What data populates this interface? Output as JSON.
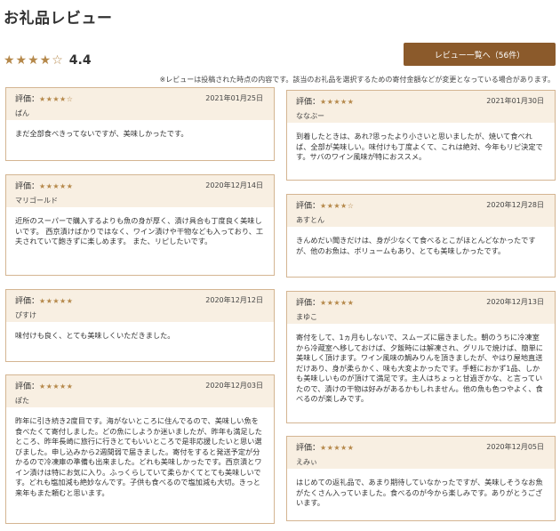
{
  "page_title": "お礼品レビュー",
  "summary": {
    "stars": "★★★★☆",
    "average": "4.4"
  },
  "list_button": "レビュー一覧へ（56件）",
  "notice": "※レビューは投稿された時点の内容です。該当のお礼品を選択するための寄付金額などが変更となっている場合があります。",
  "rating_label": "評価：",
  "reviews_left": [
    {
      "stars": "★★★★☆",
      "date": "2021年01月25日",
      "user": "ぱん",
      "text": "まだ全部食べきってないですが、美味しかったです。"
    },
    {
      "stars": "★★★★★",
      "date": "2020年12月14日",
      "user": "マリゴールド",
      "text": "近所のスーパーで購入するよりも魚の身が厚く、漬け具合も丁度良く美味しいです。 西京漬けばかりではなく、ワイン漬けや干物なども入っており、工夫されていて飽きずに楽しめます。 また、リピしたいです。"
    },
    {
      "stars": "★★★★★",
      "date": "2020年12月12日",
      "user": "ぴすけ",
      "text": "味付けも良く、とても美味しくいただきました。"
    },
    {
      "stars": "★★★★★",
      "date": "2020年12月03日",
      "user": "ぽた",
      "text": "昨年に引き続き2度目です。海がないところに住んでるので、美味しい魚を食べたくて寄付しました。どの魚にしようか迷いましたが、昨年も満足したところ、昨年長崎に旅行に行きとてもいいところで是非応援したいと思い選びました。申し込みから2週間弱で届きました。寄付をすると発送予定が分かるので冷凍庫の準備も出来ました。どれも美味しかったです。西京漬とワイン漬けは特にお気に入り。ふっくらしていて柔らかくてとても美味しいです。どれも塩加減も絶妙なんです。子供も食べるので塩加減も大切。きっと来年もまた頼むと思います。"
    }
  ],
  "reviews_right": [
    {
      "stars": "★★★★★",
      "date": "2021年01月30日",
      "user": "ななぶー",
      "text": "到着したときは、あれ?思ったより小さいと思いましたが、焼いて食べれば、全部が美味しい。味付けも丁度よくて、これは絶対、今年もリピ決定です。サバのワイン風味が特におススメ。"
    },
    {
      "stars": "★★★★☆",
      "date": "2020年12月28日",
      "user": "あすとん",
      "text": "きんめだい聞きだけは、身が少なくて食べるとこがほとんどなかったですが、他のお魚は、ボリュームもあり、とても美味しかったです。"
    },
    {
      "stars": "★★★★★",
      "date": "2020年12月13日",
      "user": "まゆこ",
      "text": "寄付をして、1ヵ月もしないで、スムーズに届きました。朝のうちに冷凍室から冷蔵室へ移しておけば、夕飯時には解凍され、グリルで焼けば、簡単に美味しく頂けます。ワイン風味の鯛みりんを頂きましたが、やはり屋地直送だけあり、身が柔らかく、味も大変よかったです。手軽におかず1品、しかも美味しいものが頂けて満足です。主人はちょっと甘過ぎかな、と言っていたので、漬けの干物は好みがあるかもしれません。他の魚も色つやよく、食べるのが楽しみです。"
    },
    {
      "stars": "★★★★★",
      "date": "2020年12月05日",
      "user": "えみぃ",
      "text": "はじめての返礼品で、あまり期待していなかったですが、美味しそうなお魚がたくさん入っていました。食べるのが今から楽しみです。ありがとうございます。"
    }
  ]
}
